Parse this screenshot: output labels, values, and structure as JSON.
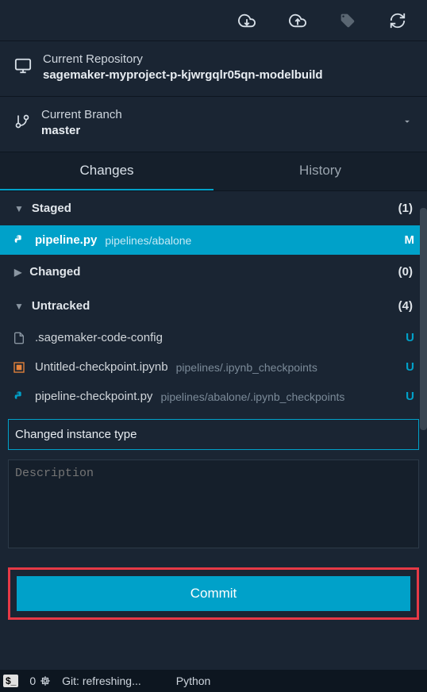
{
  "toolbar": {
    "icons": [
      "cloud-download",
      "cloud-upload",
      "tag",
      "refresh"
    ]
  },
  "repository": {
    "label": "Current Repository",
    "name": "sagemaker-myproject-p-kjwrgqlr05qn-modelbuild"
  },
  "branch": {
    "label": "Current Branch",
    "name": "master"
  },
  "tabs": {
    "changes": "Changes",
    "history": "History"
  },
  "sections": {
    "staged": {
      "title": "Staged",
      "count": "(1)"
    },
    "changed": {
      "title": "Changed",
      "count": "(0)"
    },
    "untracked": {
      "title": "Untracked",
      "count": "(4)"
    }
  },
  "staged_files": [
    {
      "name": "pipeline.py",
      "path": "pipelines/abalone",
      "status": "M"
    }
  ],
  "untracked_files": [
    {
      "name": ".sagemaker-code-config",
      "path": "",
      "status": "U"
    },
    {
      "name": "Untitled-checkpoint.ipynb",
      "path": "pipelines/.ipynb_checkpoints",
      "status": "U"
    },
    {
      "name": "pipeline-checkpoint.py",
      "path": "pipelines/abalone/.ipynb_checkpoints",
      "status": "U"
    }
  ],
  "commit": {
    "summary_value": "Changed instance type",
    "description_placeholder": "Description",
    "button": "Commit"
  },
  "statusbar": {
    "errors": "0",
    "git": "Git: refreshing...",
    "lang": "Python"
  }
}
